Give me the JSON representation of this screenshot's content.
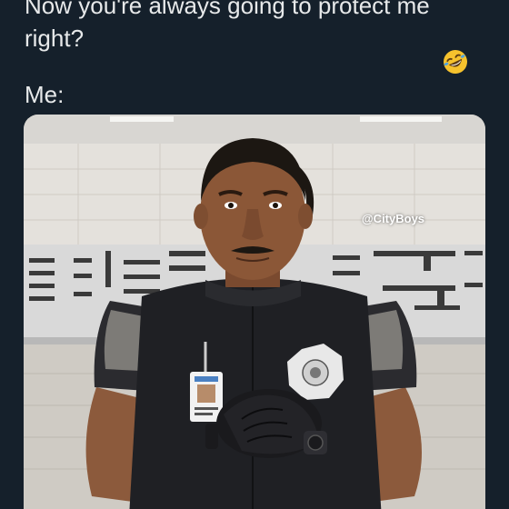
{
  "tweet": {
    "text_line_1": "Now you're always going to protect me",
    "text_line_2": "right?",
    "text_line_3": "Me:",
    "emoji": "rolling-on-the-floor-laughing-emoji"
  },
  "media": {
    "watermark": "@CityBoys",
    "subject": "man-in-security-uniform-photo"
  },
  "colors": {
    "background": "#15202b",
    "text": "#e7e9ea",
    "emoji_yellow": "#f6c22d"
  }
}
